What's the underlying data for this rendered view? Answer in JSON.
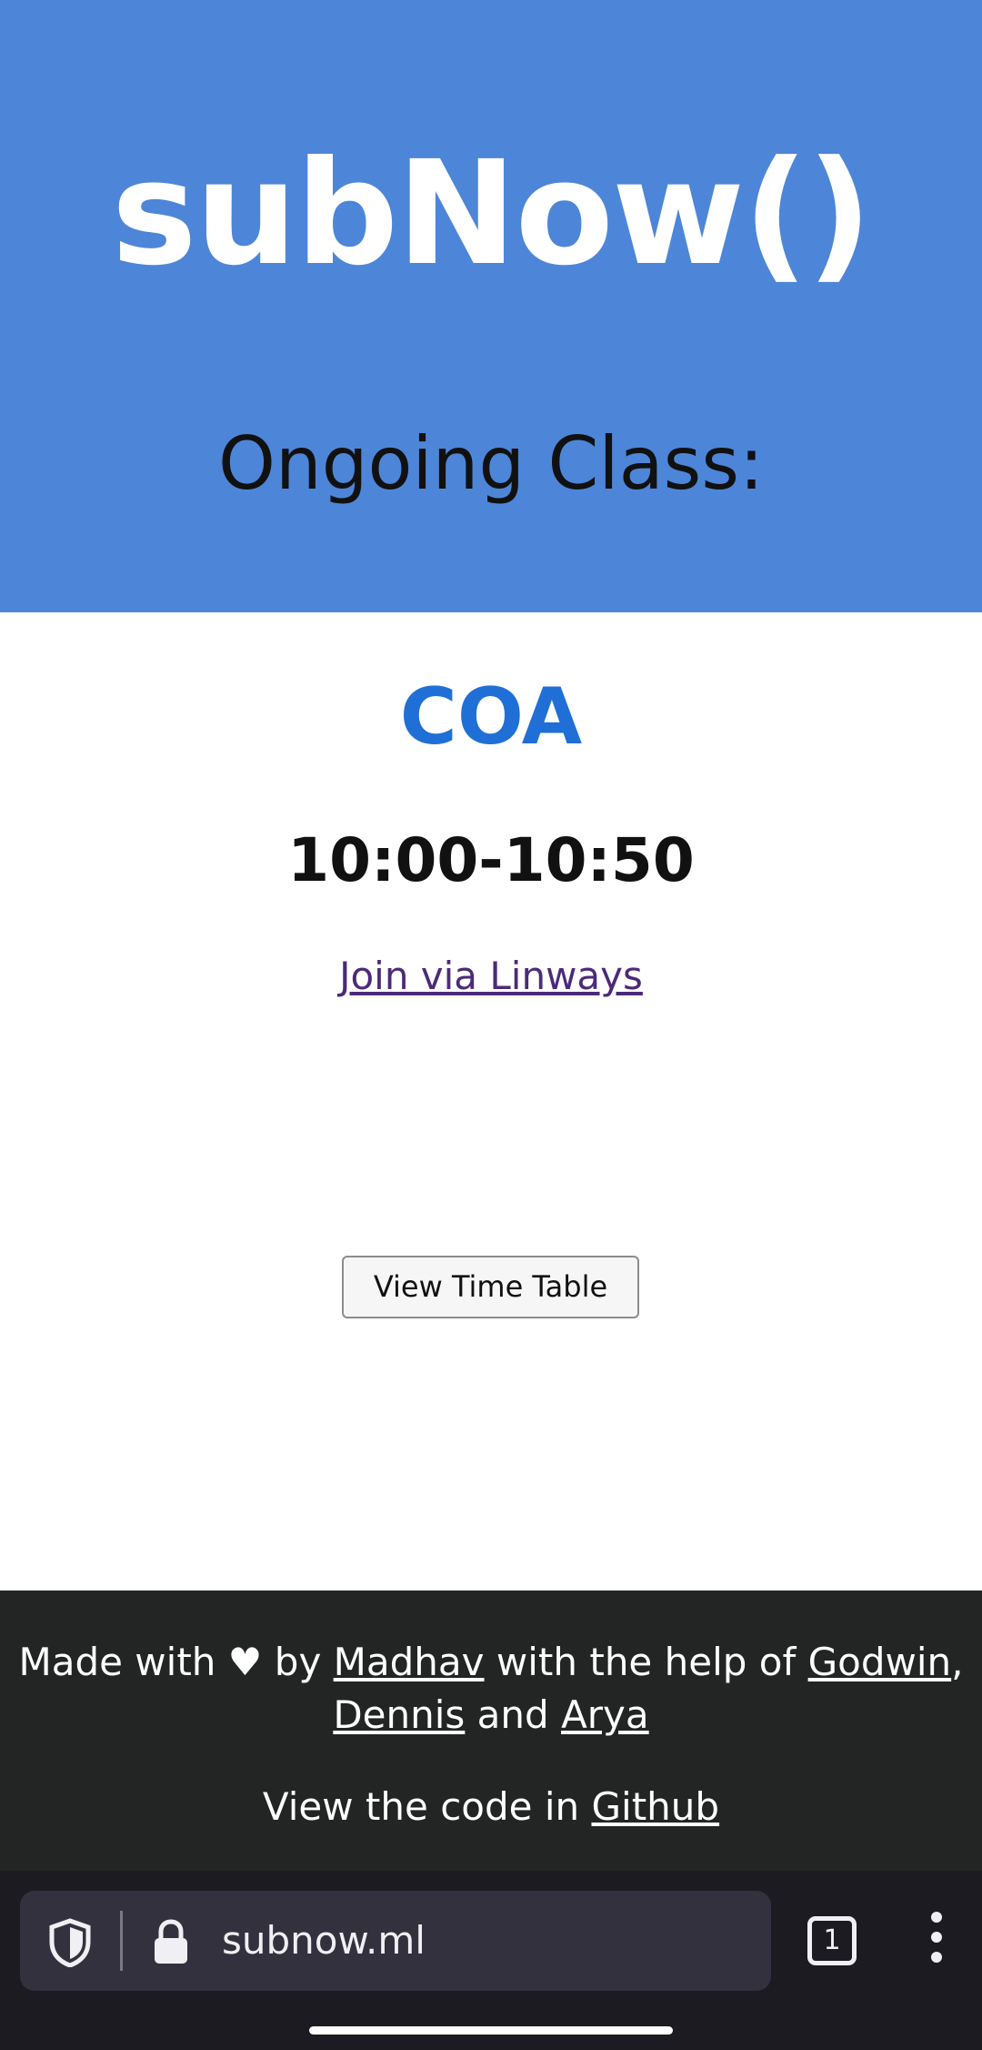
{
  "header": {
    "app_title": "subNow()",
    "ongoing_label": "Ongoing Class:"
  },
  "class_info": {
    "subject": "COA",
    "time": "10:00-10:50",
    "join_link_label": "Join via Linways"
  },
  "timetable_button_label": "View Time Table",
  "footer": {
    "made_with": "Made with",
    "heart": "♥",
    "by": "by",
    "author": "Madhav",
    "with_help": "with the help of",
    "helper1": "Godwin",
    "comma": ",",
    "helper2": "Dennis",
    "and": "and",
    "helper3": "Arya",
    "view_code": "View the code in",
    "github": "Github"
  },
  "browser": {
    "url": "subnow.ml",
    "tab_count": "1",
    "icons": [
      "shield-icon",
      "lock-icon",
      "tabs-icon",
      "menu-icon"
    ]
  },
  "colors": {
    "header_bg": "#4d86d8",
    "subject": "#1f6fd6",
    "footer_bg": "#232525",
    "browser_bg": "#1c1b22"
  }
}
